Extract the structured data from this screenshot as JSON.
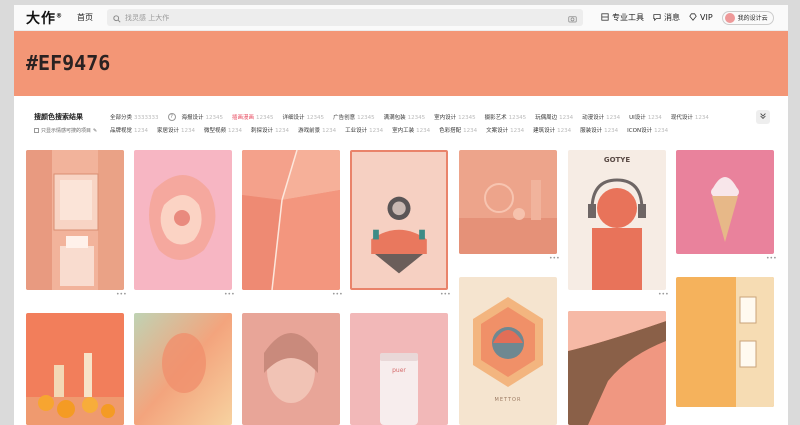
{
  "header": {
    "logo": "大作",
    "home": "首页",
    "search_placeholder": "找灵感  上大作",
    "tools": [
      "专业工具",
      "消息",
      "VIP"
    ],
    "user_label": "我的设计云"
  },
  "hero": {
    "title": "#EF9476"
  },
  "filter": {
    "title": "搜颜色搜索结果",
    "checkbox_label": "只显示情感可搜的项目",
    "rows": [
      [
        {
          "label": "全部分类",
          "count": "3333333"
        },
        {
          "label": "?",
          "count": "",
          "help": true
        },
        {
          "label": "海报设计",
          "count": "12345"
        },
        {
          "label": "插画漫画",
          "count": "12345",
          "active": true
        },
        {
          "label": "详细设计",
          "count": "12345"
        },
        {
          "label": "广告创意",
          "count": "12345"
        },
        {
          "label": "满满包装",
          "count": "12345"
        },
        {
          "label": "室内设计",
          "count": "12345"
        },
        {
          "label": "摄影艺术",
          "count": "12345"
        },
        {
          "label": "玩偶周边",
          "count": "1234"
        },
        {
          "label": "动漫设计",
          "count": "1234"
        },
        {
          "label": "UI设计",
          "count": "1234"
        },
        {
          "label": "现代设计",
          "count": "1234"
        }
      ],
      [
        {
          "label": "品牌视觉",
          "count": "1234"
        },
        {
          "label": "家居设计",
          "count": "1234"
        },
        {
          "label": "微型视频",
          "count": "1234"
        },
        {
          "label": "刺探设计",
          "count": "1234"
        },
        {
          "label": "游戏前景",
          "count": "1234"
        },
        {
          "label": "工业设计",
          "count": "1234"
        },
        {
          "label": "室内工装",
          "count": "1234"
        },
        {
          "label": "色彩搭配",
          "count": "1234"
        },
        {
          "label": "文案设计",
          "count": "1234"
        },
        {
          "label": "建筑设计",
          "count": "1234"
        },
        {
          "label": "服装设计",
          "count": "1234"
        },
        {
          "label": "ICON设计",
          "count": "1234"
        }
      ]
    ]
  },
  "cards": [
    {
      "text1": "",
      "text2": ""
    },
    {
      "text1": "",
      "text2": ""
    },
    {
      "text1": "",
      "text2": ""
    },
    {
      "text1": "",
      "text2": ""
    },
    {
      "text1": "",
      "text2": ""
    },
    {
      "text1": "GOTYE",
      "text2": ""
    },
    {
      "text1": "",
      "text2": ""
    },
    {
      "text1": "",
      "text2": ""
    },
    {
      "text1": "",
      "text2": ""
    },
    {
      "text1": "",
      "text2": ""
    },
    {
      "text1": "puer",
      "text2": ""
    },
    {
      "text1": "METTOR",
      "text2": ""
    },
    {
      "text1": "",
      "text2": ""
    },
    {
      "text1": "",
      "text2": ""
    }
  ],
  "more_dots": "•••",
  "colors": {
    "accent": "#EF9476",
    "active_tag": "#e84a5f"
  },
  "icons": [
    "search-icon",
    "camera-icon",
    "tool-icon",
    "message-icon",
    "diamond-icon",
    "chevron-down-icon",
    "help-icon"
  ]
}
